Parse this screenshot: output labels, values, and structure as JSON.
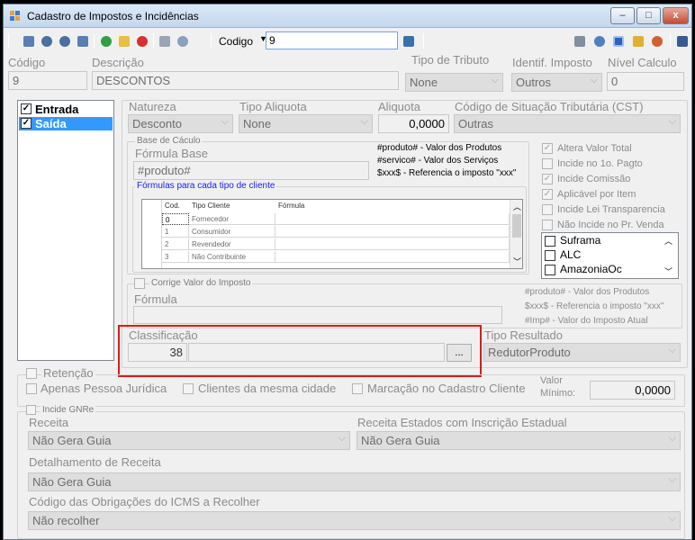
{
  "window": {
    "title": "Cadastro de Impostos e Incidências",
    "buttons": {
      "minimize": "–",
      "maximize": "□",
      "close": "x"
    }
  },
  "toolbar": {
    "codigo_label": "Codigo",
    "codigo_value": "9"
  },
  "header": {
    "codigo_label": "Código",
    "codigo_value": "9",
    "descricao_label": "Descrição",
    "descricao_value": "DESCONTOS",
    "tipo_tributo_label": "Tipo de Tributo",
    "tipo_tributo_value": "None",
    "identif_label": "Identif. Imposto",
    "identif_value": "Outros",
    "nivel_label": "Nível Calculo",
    "nivel_value": "0"
  },
  "tipo_list": [
    {
      "label": "Entrada",
      "checked": "✓"
    },
    {
      "label": "Saída",
      "checked": "✓"
    }
  ],
  "detail": {
    "natureza_label": "Natureza",
    "natureza_value": "Desconto",
    "tipo_aliquota_label": "Tipo Aliquota",
    "tipo_aliquota_value": "None",
    "aliquota_label": "Aliquota",
    "aliquota_value": "0,0000",
    "cst_label": "Código de Situação Tributária (CST)",
    "cst_value": "Outras",
    "base_group_label": "Base de Cáculo",
    "formula_base_label": "Fórmula Base",
    "formula_base_value": "#produto#",
    "hint_1": "#produto# - Valor dos Produtos",
    "hint_2": "#servico# - Valor dos Serviços",
    "hint_3": "$xxx$ - Referencia o imposto \"xxx\"",
    "formulas_label": "Fórmulas para cada tipo de cliente"
  },
  "grid": {
    "headers": [
      "Cod.",
      "Tipo Cliente",
      "Fórmula"
    ],
    "rows": [
      {
        "cod": "0",
        "tipo": "Fornecedor",
        "formula": ""
      },
      {
        "cod": "1",
        "tipo": "Consumidor",
        "formula": ""
      },
      {
        "cod": "2",
        "tipo": "Revendedor",
        "formula": ""
      },
      {
        "cod": "3",
        "tipo": "Não Contribuinte",
        "formula": ""
      }
    ]
  },
  "options": {
    "altera_valor_total": "Altera Valor Total",
    "incide_pagto": "Incide no 1o. Pagto",
    "incide_comissao": "Incide Comissão",
    "aplicavel_item": "Aplicável por Item",
    "incide_transparencia": "Incide Lei Transparencia",
    "nao_incide_venda": "Não Incide no Pr. Venda",
    "check_mark": "✓",
    "regioes": [
      "Suframa",
      "ALC",
      "AmazoniaOc"
    ]
  },
  "corrige": {
    "label": "Corrige Valor do Imposto",
    "formula_label": "Fórmula",
    "hint_1": "#produto# - Valor dos Produtos",
    "hint_2": "$xxx$ - Referencia o imposto \"xxx\"",
    "hint_3": "#Imp# - Valor do Imposto Atual"
  },
  "classificacao": {
    "label": "Classificação",
    "value": "38",
    "browse_label": "...",
    "tipo_resultado_label": "Tipo Resultado",
    "tipo_resultado_value": "RedutorProduto"
  },
  "retencao": {
    "label": "Retenção",
    "pessoa_juridica": "Apenas Pessoa Jurídica",
    "mesma_cidade": "Clientes da mesma cidade",
    "marcacao": "Marcação no Cadastro Cliente",
    "valor_minimo_label_1": "Valor",
    "valor_minimo_label_2": "Mínimo:",
    "valor_minimo_value": "0,0000"
  },
  "gnre": {
    "incide_label": "Incide GNRe",
    "receita_label": "Receita",
    "receita_value": "Não Gera Guia",
    "receita_estados_label": "Receita Estados com Inscrição Estadual",
    "receita_estados_value": "Não Gera Guia",
    "detalhamento_label": "Detalhamento de Receita",
    "detalhamento_value": "Não Gera Guia",
    "obrigacoes_label": "Código das Obrigações do ICMS a Recolher",
    "obrigacoes_value": "Não recolher"
  }
}
